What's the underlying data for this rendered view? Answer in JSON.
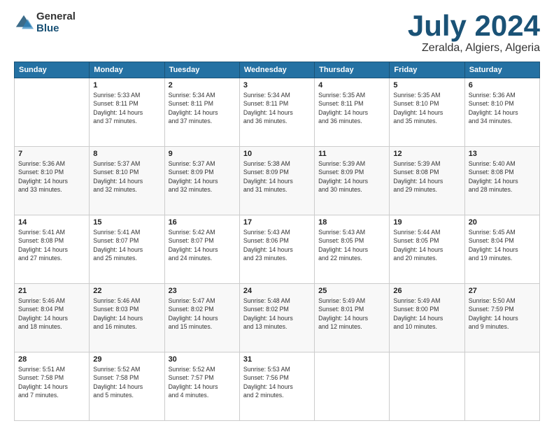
{
  "header": {
    "logo_general": "General",
    "logo_blue": "Blue",
    "month_title": "July 2024",
    "location": "Zeralda, Algiers, Algeria"
  },
  "weekdays": [
    "Sunday",
    "Monday",
    "Tuesday",
    "Wednesday",
    "Thursday",
    "Friday",
    "Saturday"
  ],
  "weeks": [
    [
      {
        "day": "",
        "info": ""
      },
      {
        "day": "1",
        "info": "Sunrise: 5:33 AM\nSunset: 8:11 PM\nDaylight: 14 hours\nand 37 minutes."
      },
      {
        "day": "2",
        "info": "Sunrise: 5:34 AM\nSunset: 8:11 PM\nDaylight: 14 hours\nand 37 minutes."
      },
      {
        "day": "3",
        "info": "Sunrise: 5:34 AM\nSunset: 8:11 PM\nDaylight: 14 hours\nand 36 minutes."
      },
      {
        "day": "4",
        "info": "Sunrise: 5:35 AM\nSunset: 8:11 PM\nDaylight: 14 hours\nand 36 minutes."
      },
      {
        "day": "5",
        "info": "Sunrise: 5:35 AM\nSunset: 8:10 PM\nDaylight: 14 hours\nand 35 minutes."
      },
      {
        "day": "6",
        "info": "Sunrise: 5:36 AM\nSunset: 8:10 PM\nDaylight: 14 hours\nand 34 minutes."
      }
    ],
    [
      {
        "day": "7",
        "info": "Sunrise: 5:36 AM\nSunset: 8:10 PM\nDaylight: 14 hours\nand 33 minutes."
      },
      {
        "day": "8",
        "info": "Sunrise: 5:37 AM\nSunset: 8:10 PM\nDaylight: 14 hours\nand 32 minutes."
      },
      {
        "day": "9",
        "info": "Sunrise: 5:37 AM\nSunset: 8:09 PM\nDaylight: 14 hours\nand 32 minutes."
      },
      {
        "day": "10",
        "info": "Sunrise: 5:38 AM\nSunset: 8:09 PM\nDaylight: 14 hours\nand 31 minutes."
      },
      {
        "day": "11",
        "info": "Sunrise: 5:39 AM\nSunset: 8:09 PM\nDaylight: 14 hours\nand 30 minutes."
      },
      {
        "day": "12",
        "info": "Sunrise: 5:39 AM\nSunset: 8:08 PM\nDaylight: 14 hours\nand 29 minutes."
      },
      {
        "day": "13",
        "info": "Sunrise: 5:40 AM\nSunset: 8:08 PM\nDaylight: 14 hours\nand 28 minutes."
      }
    ],
    [
      {
        "day": "14",
        "info": "Sunrise: 5:41 AM\nSunset: 8:08 PM\nDaylight: 14 hours\nand 27 minutes."
      },
      {
        "day": "15",
        "info": "Sunrise: 5:41 AM\nSunset: 8:07 PM\nDaylight: 14 hours\nand 25 minutes."
      },
      {
        "day": "16",
        "info": "Sunrise: 5:42 AM\nSunset: 8:07 PM\nDaylight: 14 hours\nand 24 minutes."
      },
      {
        "day": "17",
        "info": "Sunrise: 5:43 AM\nSunset: 8:06 PM\nDaylight: 14 hours\nand 23 minutes."
      },
      {
        "day": "18",
        "info": "Sunrise: 5:43 AM\nSunset: 8:05 PM\nDaylight: 14 hours\nand 22 minutes."
      },
      {
        "day": "19",
        "info": "Sunrise: 5:44 AM\nSunset: 8:05 PM\nDaylight: 14 hours\nand 20 minutes."
      },
      {
        "day": "20",
        "info": "Sunrise: 5:45 AM\nSunset: 8:04 PM\nDaylight: 14 hours\nand 19 minutes."
      }
    ],
    [
      {
        "day": "21",
        "info": "Sunrise: 5:46 AM\nSunset: 8:04 PM\nDaylight: 14 hours\nand 18 minutes."
      },
      {
        "day": "22",
        "info": "Sunrise: 5:46 AM\nSunset: 8:03 PM\nDaylight: 14 hours\nand 16 minutes."
      },
      {
        "day": "23",
        "info": "Sunrise: 5:47 AM\nSunset: 8:02 PM\nDaylight: 14 hours\nand 15 minutes."
      },
      {
        "day": "24",
        "info": "Sunrise: 5:48 AM\nSunset: 8:02 PM\nDaylight: 14 hours\nand 13 minutes."
      },
      {
        "day": "25",
        "info": "Sunrise: 5:49 AM\nSunset: 8:01 PM\nDaylight: 14 hours\nand 12 minutes."
      },
      {
        "day": "26",
        "info": "Sunrise: 5:49 AM\nSunset: 8:00 PM\nDaylight: 14 hours\nand 10 minutes."
      },
      {
        "day": "27",
        "info": "Sunrise: 5:50 AM\nSunset: 7:59 PM\nDaylight: 14 hours\nand 9 minutes."
      }
    ],
    [
      {
        "day": "28",
        "info": "Sunrise: 5:51 AM\nSunset: 7:58 PM\nDaylight: 14 hours\nand 7 minutes."
      },
      {
        "day": "29",
        "info": "Sunrise: 5:52 AM\nSunset: 7:58 PM\nDaylight: 14 hours\nand 5 minutes."
      },
      {
        "day": "30",
        "info": "Sunrise: 5:52 AM\nSunset: 7:57 PM\nDaylight: 14 hours\nand 4 minutes."
      },
      {
        "day": "31",
        "info": "Sunrise: 5:53 AM\nSunset: 7:56 PM\nDaylight: 14 hours\nand 2 minutes."
      },
      {
        "day": "",
        "info": ""
      },
      {
        "day": "",
        "info": ""
      },
      {
        "day": "",
        "info": ""
      }
    ]
  ]
}
